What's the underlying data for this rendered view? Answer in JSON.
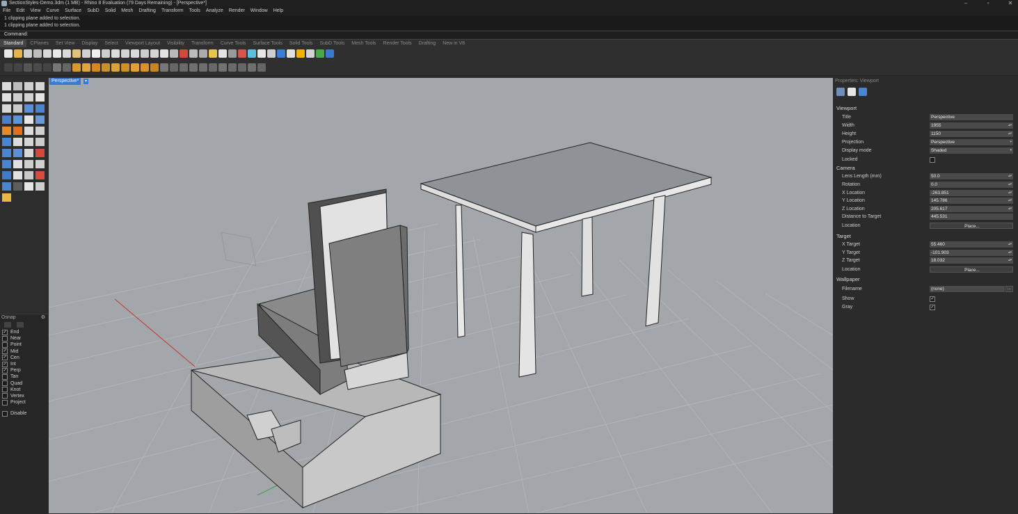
{
  "window": {
    "title": "SectionStyles-Demo.3dm (1 MB) - Rhino 8 Evaluation (79 Days Remaining) - [Perspective*]"
  },
  "menu": [
    "File",
    "Edit",
    "View",
    "Curve",
    "Surface",
    "SubD",
    "Solid",
    "Mesh",
    "Drafting",
    "Transform",
    "Tools",
    "Analyze",
    "Render",
    "Window",
    "Help"
  ],
  "history": [
    "1 clipping plane added to selection.",
    "1 clipping plane added to selection."
  ],
  "command": {
    "label": "Command:"
  },
  "tabs": [
    "Standard",
    "CPlanes",
    "Set View",
    "Display",
    "Select",
    "Viewport Layout",
    "Visibility",
    "Transform",
    "Curve Tools",
    "Surface Tools",
    "Solid Tools",
    "SubD Tools",
    "Mesh Tools",
    "Render Tools",
    "Drafting",
    "New in V8"
  ],
  "viewport": {
    "title": "Perspective*"
  },
  "osnap": {
    "title": "Osnap",
    "items": [
      {
        "label": "End",
        "checked": true
      },
      {
        "label": "Near",
        "checked": false
      },
      {
        "label": "Point",
        "checked": false
      },
      {
        "label": "Mid",
        "checked": true
      },
      {
        "label": "Cen",
        "checked": true
      },
      {
        "label": "Int",
        "checked": true
      },
      {
        "label": "Perp",
        "checked": true
      },
      {
        "label": "Tan",
        "checked": false
      },
      {
        "label": "Quad",
        "checked": false
      },
      {
        "label": "Knot",
        "checked": false
      },
      {
        "label": "Vertex",
        "checked": false
      },
      {
        "label": "Project",
        "checked": false
      }
    ],
    "disable": "Disable"
  },
  "properties": {
    "title": "Properties: Viewport",
    "viewport_section": "Viewport",
    "title_label": "Title",
    "title_value": "Perspective",
    "width_label": "Width",
    "width_value": "1955",
    "height_label": "Height",
    "height_value": "1150",
    "projection_label": "Projection",
    "projection_value": "Perspective",
    "display_label": "Display mode",
    "display_value": "Shaded",
    "locked_label": "Locked",
    "camera_section": "Camera",
    "lens_label": "Lens Length (mm)",
    "lens_value": "50.0",
    "rotation_label": "Rotation",
    "rotation_value": "0.0",
    "cx_label": "X Location",
    "cx_value": "-263.851",
    "cy_label": "Y Location",
    "cy_value": "145.786",
    "cz_label": "Z Location",
    "cz_value": "205.617",
    "dist_label": "Distance to Target",
    "dist_value": "445.531",
    "loc_label": "Location",
    "place": "Place...",
    "target_section": "Target",
    "tx_label": "X Target",
    "tx_value": "55.460",
    "ty_label": "Y Target",
    "ty_value": "-101.903",
    "tz_label": "Z Target",
    "tz_value": "18.032",
    "tloc_label": "Location",
    "wallpaper_section": "Wallpaper",
    "filename_label": "Filename",
    "filename_value": "(none)",
    "browse": "...",
    "show_label": "Show",
    "gray_label": "Gray"
  }
}
